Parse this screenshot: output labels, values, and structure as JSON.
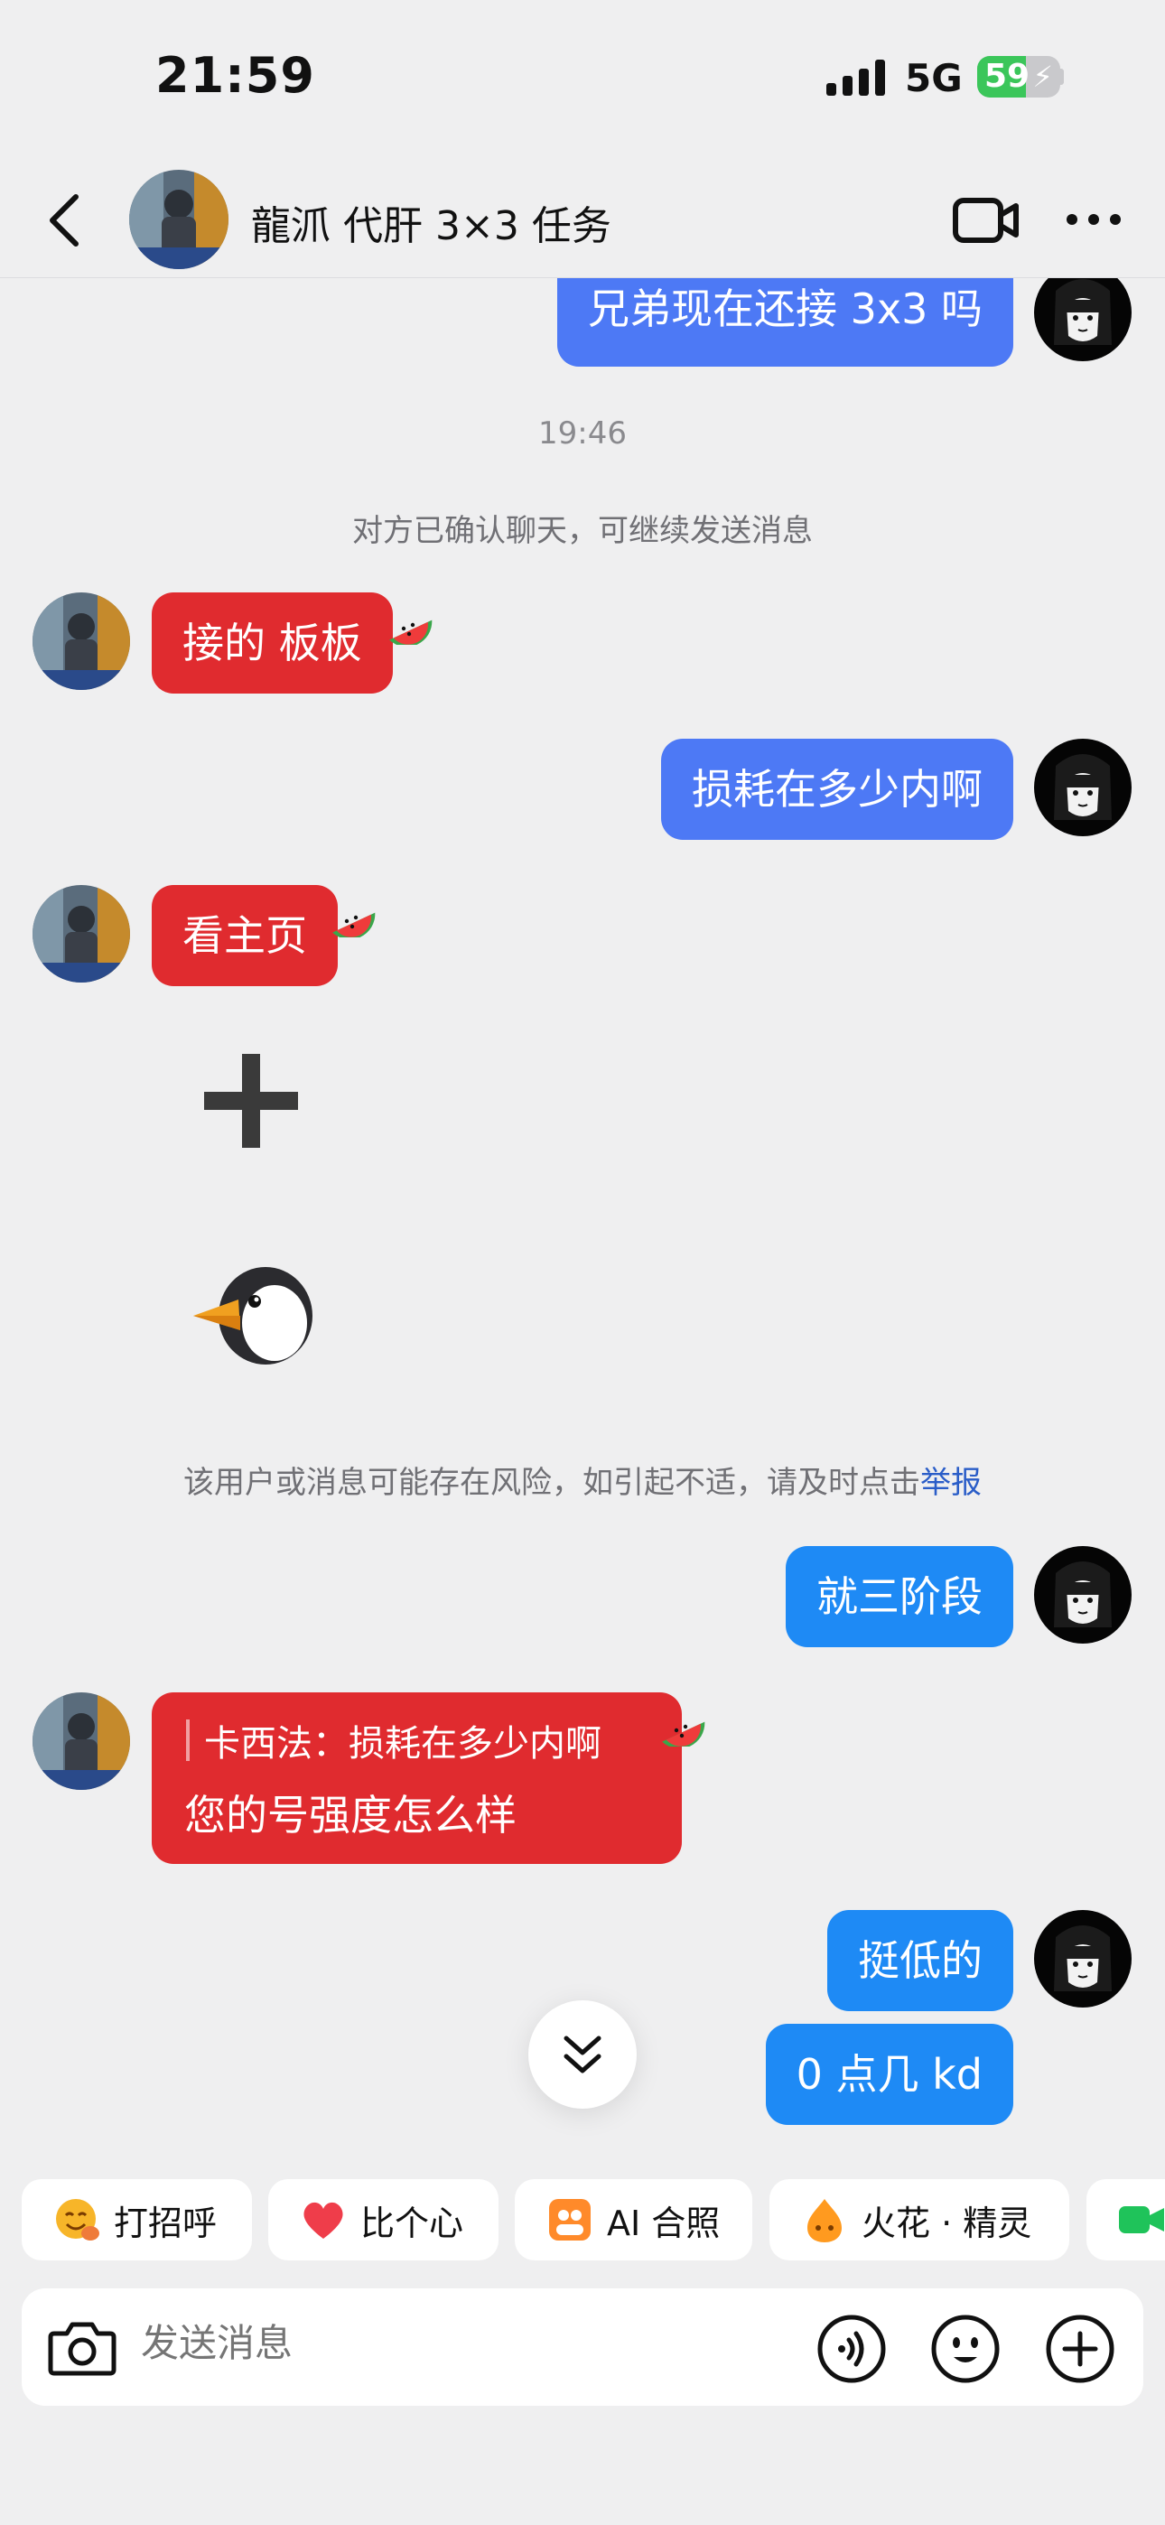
{
  "status_bar": {
    "time": "21:59",
    "network": "5G",
    "battery": "59",
    "battery_level": 0.59
  },
  "header": {
    "title": "龍沠 代肝 3×3 任务"
  },
  "messages": {
    "m1": "兄弟现在还接 3x3 吗",
    "time1": "19:46",
    "system1": "对方已确认聊天，可继续发送消息",
    "m2": "接的 板板",
    "m3": "损耗在多少内啊",
    "m4": "看主页",
    "risk_text": "该用户或消息可能存在风险，如引起不适，请及时点击",
    "risk_link": "举报",
    "m5": "就三阶段",
    "quote": "卡西法：损耗在多少内啊",
    "m6": "您的号强度怎么样",
    "m7": "挺低的",
    "m8": "0 点几 kd"
  },
  "chips": [
    {
      "label": "打招呼",
      "icon": "smile-hand-icon"
    },
    {
      "label": "比个心",
      "icon": "heart-icon"
    },
    {
      "label": "AI 合照",
      "icon": "ai-photo-icon"
    },
    {
      "label": "火花 · 精灵",
      "icon": "spark-sprite-icon"
    },
    {
      "label": "",
      "icon": "video-chip-icon"
    }
  ],
  "input": {
    "placeholder": "发送消息"
  },
  "colors": {
    "red_bubble": "#e02b2f",
    "blue_bubble": "#4d79f5",
    "sky_bubble": "#1e8af5",
    "background": "#efeff0"
  }
}
